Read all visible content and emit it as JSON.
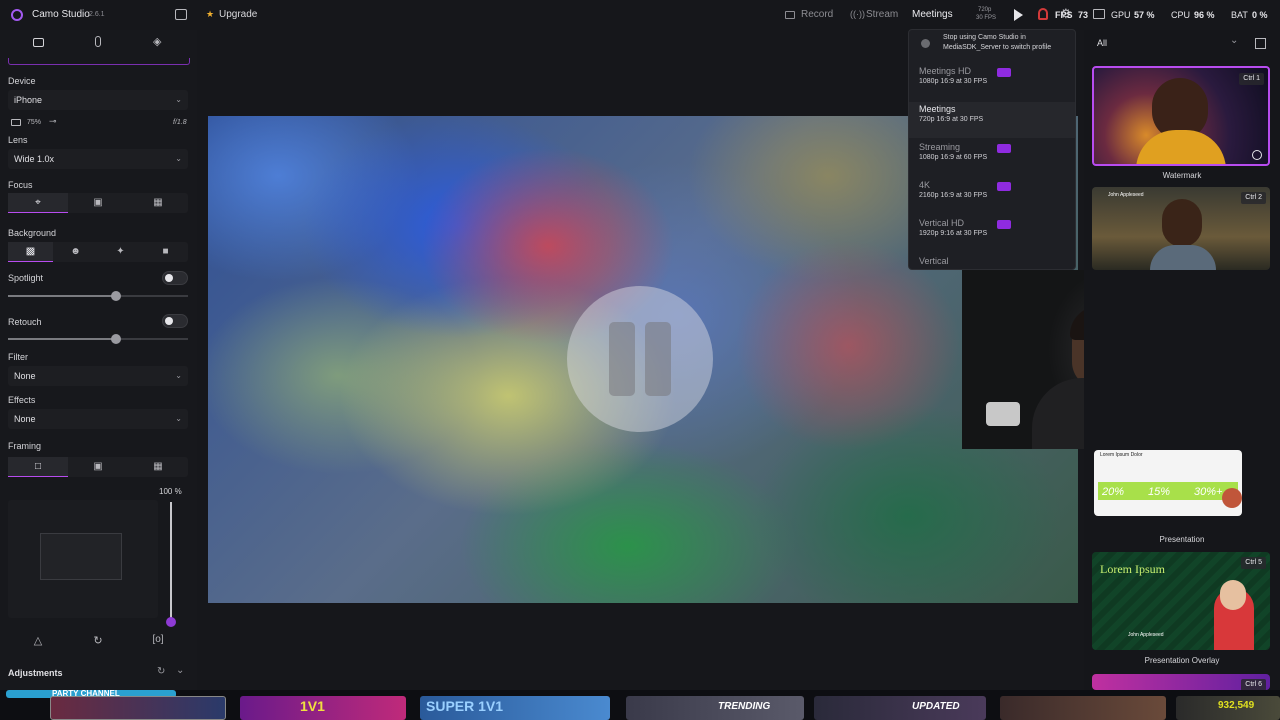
{
  "app": {
    "name": "Camo Studio",
    "version": "2.6.1",
    "upgrade_label": "Upgrade"
  },
  "topbar": {
    "record_label": "Record",
    "stream_label": "Stream",
    "profile_label": "Meetings",
    "profile_res": "720p",
    "profile_fps": "30 FPS",
    "stats": {
      "fps_label": "FPS",
      "fps_value": "73",
      "gpu_label": "GPU",
      "gpu_value": "57 %",
      "cpu_label": "CPU",
      "cpu_value": "96 %",
      "bat_label": "BAT",
      "bat_value": "0 %"
    }
  },
  "sidebar": {
    "tabs": [
      {
        "icon": "video-camera-icon"
      },
      {
        "icon": "microphone-icon"
      },
      {
        "icon": "layers-icon"
      }
    ],
    "device_label": "Device",
    "device_value": "iPhone",
    "zoom_value": "75%",
    "aperture_value": "f/1.8",
    "lens_label": "Lens",
    "lens_value": "Wide 1.0x",
    "focus_label": "Focus",
    "background_label": "Background",
    "spotlight_label": "Spotlight",
    "spotlight_level": 0.6,
    "retouch_label": "Retouch",
    "retouch_level": 0.6,
    "filter_label": "Filter",
    "filter_value": "None",
    "effects_label": "Effects",
    "effects_value": "None",
    "framing_label": "Framing",
    "zoom_level_value": "100 %",
    "adjustments_label": "Adjustments"
  },
  "dropdown": {
    "notice": [
      "Stop using Camo Studio in",
      "MediaSDK_Server to switch profile"
    ],
    "items": [
      {
        "title": "Meetings HD",
        "sub": "1080p 16:9 at 30 FPS",
        "pro": true,
        "selected": false
      },
      {
        "title": "Meetings",
        "sub": "720p 16:9 at 30 FPS",
        "pro": false,
        "selected": true
      },
      {
        "title": "Streaming",
        "sub": "1080p 16:9 at 60 FPS",
        "pro": true,
        "selected": false
      },
      {
        "title": "4K",
        "sub": "2160p 16:9 at 30 FPS",
        "pro": true,
        "selected": false
      },
      {
        "title": "Vertical HD",
        "sub": "1920p 9:16 at 30 FPS",
        "pro": true,
        "selected": false
      },
      {
        "title": "Vertical",
        "sub": "",
        "pro": false,
        "selected": false
      }
    ]
  },
  "rightpanel": {
    "filter_value": "All",
    "scenes": [
      {
        "label": "Watermark",
        "shortcut": "Ctrl 1"
      },
      {
        "label": "",
        "shortcut": "Ctrl 2",
        "name": "John Appleseed"
      },
      {
        "label": "Presentation",
        "shortcut": "",
        "title": "Lorem Ipsum Dolor",
        "stats": [
          "20%",
          "15%",
          "30%+"
        ]
      },
      {
        "label": "Presentation Overlay",
        "shortcut": "Ctrl 5",
        "title": "Lorem Ipsum",
        "name": "John Appleseed"
      },
      {
        "label": "",
        "shortcut": "Ctrl 6"
      }
    ]
  },
  "taskbar": {
    "channel_label": "PARTY CHANNEL",
    "tiles": [
      "1V1",
      "SUPER 1V1",
      "TRENDING",
      "UPDATED",
      "932,549"
    ]
  },
  "colors": {
    "accent": "#b84cf0",
    "pro_badge": "#8f2be0",
    "background": "#16171b"
  }
}
